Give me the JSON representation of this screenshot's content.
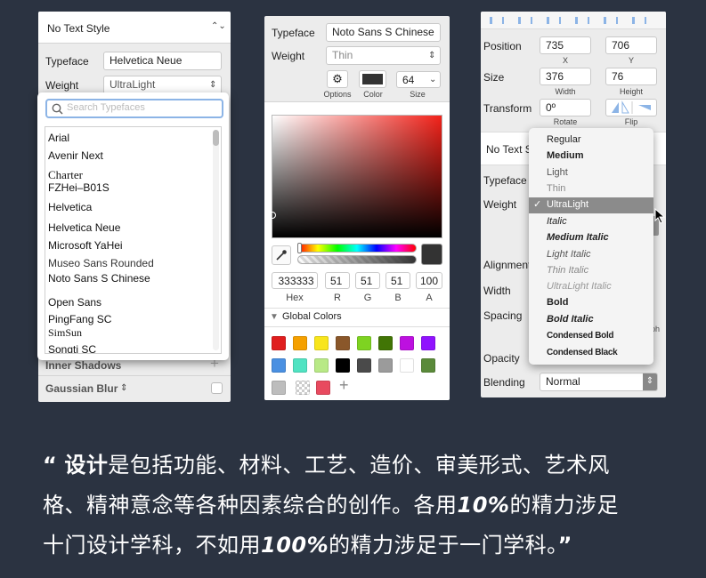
{
  "panel1": {
    "text_style": "No Text Style",
    "typeface_label": "Typeface",
    "typeface_value": "Helvetica Neue",
    "weight_label": "Weight",
    "weight_value": "UltraLight",
    "search_placeholder": "Search Typefaces",
    "fonts": [
      "Arial",
      "Avenir Next",
      "Charter",
      "FZHei–B01S",
      "Helvetica",
      "Helvetica Neue",
      "Microsoft YaHei",
      "Museo Sans Rounded",
      "Noto Sans S Chinese",
      "Open Sans",
      "PingFang SC",
      "SimSun",
      "Songti SC"
    ],
    "inner_shadows": "Inner Shadows",
    "gaussian_blur": "Gaussian Blur"
  },
  "panel2": {
    "typeface_label": "Typeface",
    "typeface_value": "Noto Sans S Chinese",
    "weight_label": "Weight",
    "weight_value": "Thin",
    "options_label": "Options",
    "color_label": "Color",
    "size_value": "64",
    "size_label": "Size",
    "hex": "333333",
    "r": "51",
    "g": "51",
    "b": "51",
    "a": "100",
    "hex_label": "Hex",
    "r_label": "R",
    "g_label": "G",
    "b_label": "B",
    "a_label": "A",
    "global_colors": "Global Colors",
    "swatches": [
      "#e01e1e",
      "#f5a000",
      "#f8e51c",
      "#8a572a",
      "#7ed321",
      "#417505",
      "#bd10e0",
      "#9013fe",
      "#4a90e2",
      "#50e3c2",
      "#b8e986",
      "#000000",
      "#4a4a4a",
      "#9b9b9b",
      "#ffffff",
      "#5a8a3a",
      "#bdbdbd",
      "#d0021b"
    ]
  },
  "panel3": {
    "position_label": "Position",
    "pos_x": "735",
    "pos_y": "706",
    "x_label": "X",
    "y_label": "Y",
    "size_label": "Size",
    "width_value": "376",
    "height_value": "76",
    "width_label": "Width",
    "height_label": "Height",
    "transform_label": "Transform",
    "rotate_value": "0º",
    "rotate_label": "Rotate",
    "flip_label": "Flip",
    "text_style": "No Text S",
    "typeface_label": "Typeface",
    "weight_label": "Weight",
    "alignment_label": "Alignment",
    "width_label2": "Width",
    "spacing_label": "Spacing",
    "opacity_label": "Opacity",
    "blending_label": "Blending",
    "blending_value": "Normal",
    "spacing_unit": "ph",
    "weights": [
      "Regular",
      "Medium",
      "Light",
      "Thin",
      "UltraLight",
      "Italic",
      "Medium Italic",
      "Light Italic",
      "Thin Italic",
      "UltraLight Italic",
      "Bold",
      "Bold Italic",
      "Condensed Bold",
      "Condensed Black"
    ],
    "selected_weight": "UltraLight",
    "checkmark": "✓"
  },
  "quote": {
    "open": "“",
    "l1_bold": "设计",
    "l1_rest": "是包括功能、材料、工艺、造价、审美形式、艺术风",
    "l2_a": "格、精神意念等各种因素综合的创作。各用",
    "l2_b": "10%",
    "l2_c": "的精力涉足",
    "l3_a": "十门设计学科，不如用",
    "l3_b": "100%",
    "l3_c": "的精力涉足于一门学科。",
    "close": "”"
  }
}
